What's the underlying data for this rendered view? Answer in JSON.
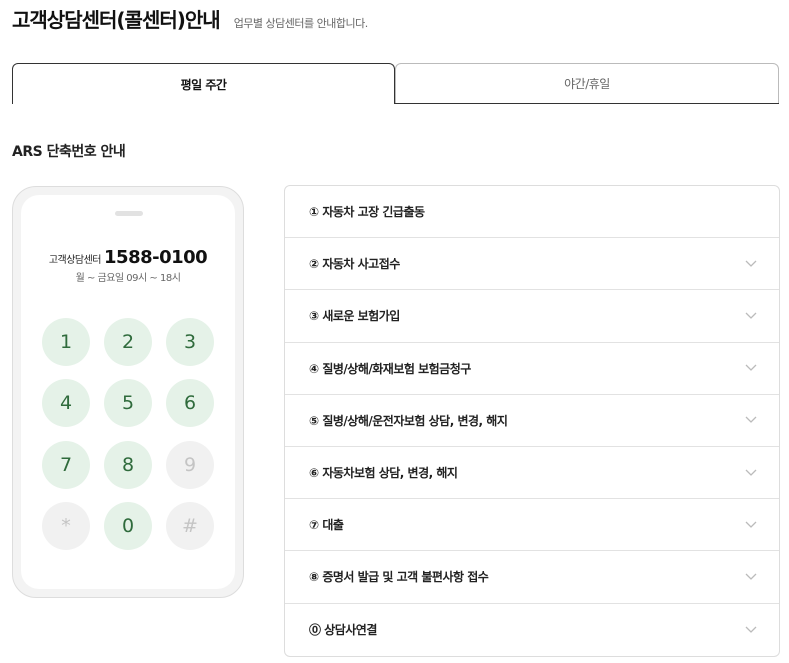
{
  "header": {
    "title": "고객상담센터(콜센터)안내",
    "subtitle": "업무별 상담센터를 안내합니다."
  },
  "tabs": [
    {
      "label": "평일 주간",
      "active": true
    },
    {
      "label": "야간/휴일",
      "active": false
    }
  ],
  "section_title": "ARS 단축번호 안내",
  "phone": {
    "center_name": "고객상담센터",
    "center_number": "1588-0100",
    "hours": "월 ~ 금요일 09시 ~ 18시",
    "keypad": [
      {
        "label": "1",
        "enabled": true
      },
      {
        "label": "2",
        "enabled": true
      },
      {
        "label": "3",
        "enabled": true
      },
      {
        "label": "4",
        "enabled": true
      },
      {
        "label": "5",
        "enabled": true
      },
      {
        "label": "6",
        "enabled": true
      },
      {
        "label": "7",
        "enabled": true
      },
      {
        "label": "8",
        "enabled": true
      },
      {
        "label": "9",
        "enabled": false
      },
      {
        "label": "*",
        "enabled": false
      },
      {
        "label": "0",
        "enabled": true
      },
      {
        "label": "#",
        "enabled": false
      }
    ]
  },
  "menu": {
    "items": [
      {
        "label": "① 자동차 고장 긴급출동",
        "expandable": false
      },
      {
        "label": "② 자동차 사고접수",
        "expandable": true
      },
      {
        "label": "③ 새로운 보험가입",
        "expandable": true
      },
      {
        "label": "④ 질병/상해/화재보험 보험금청구",
        "expandable": true
      },
      {
        "label": "⑤ 질병/상해/운전자보험 상담, 변경, 해지",
        "expandable": true
      },
      {
        "label": "⑥ 자동차보험 상담, 변경, 해지",
        "expandable": true
      },
      {
        "label": "⑦ 대출",
        "expandable": true
      },
      {
        "label": "⑧ 증명서 발급 및 고객 불편사항 접수",
        "expandable": true
      },
      {
        "label": "⓪ 상담사연결",
        "expandable": true
      }
    ]
  },
  "colors": {
    "key_active_bg": "#e5f2e8",
    "key_active_text": "#2f6b3c",
    "key_disabled_bg": "#f1f1f1",
    "key_disabled_text": "#c4c4c4"
  },
  "icons": {
    "menu_expand": "chevron-down-icon"
  }
}
